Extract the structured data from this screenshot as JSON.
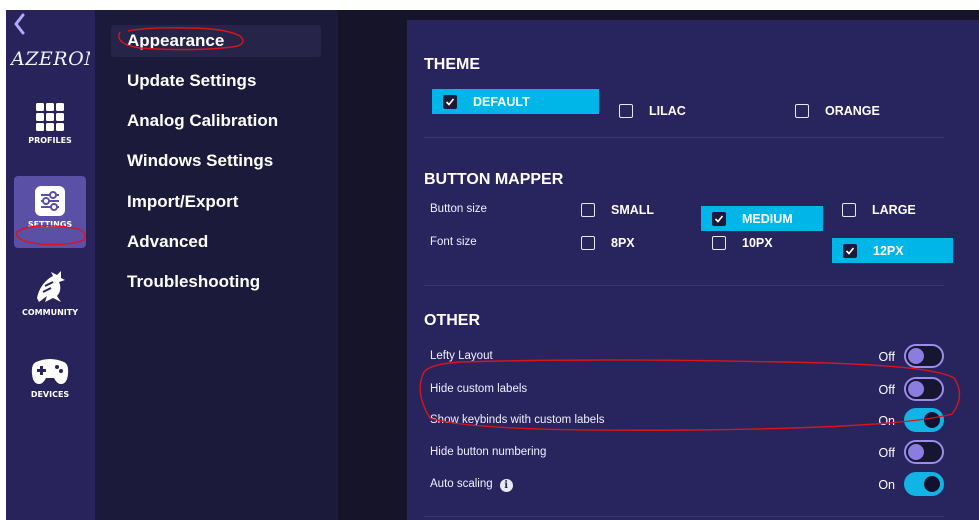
{
  "app": {
    "logo_text": "AZERON"
  },
  "rail": {
    "items": [
      {
        "label": "PROFILES",
        "icon": "grid-icon"
      },
      {
        "label": "SETTINGS",
        "icon": "sliders-icon",
        "active": true
      },
      {
        "label": "COMMUNITY",
        "icon": "dragon-icon"
      },
      {
        "label": "DEVICES",
        "icon": "gamepad-icon"
      }
    ]
  },
  "menu": {
    "items": [
      {
        "label": "Appearance",
        "active": true
      },
      {
        "label": "Update Settings"
      },
      {
        "label": "Analog Calibration"
      },
      {
        "label": "Windows Settings"
      },
      {
        "label": "Import/Export"
      },
      {
        "label": "Advanced"
      },
      {
        "label": "Troubleshooting"
      }
    ]
  },
  "theme": {
    "title": "THEME",
    "options": [
      {
        "label": "DEFAULT",
        "checked": true
      },
      {
        "label": "LILAC",
        "checked": false
      },
      {
        "label": "ORANGE",
        "checked": false
      }
    ]
  },
  "button_mapper": {
    "title": "BUTTON MAPPER",
    "button_size": {
      "label": "Button size",
      "options": [
        {
          "label": "SMALL",
          "checked": false
        },
        {
          "label": "MEDIUM",
          "checked": true
        },
        {
          "label": "LARGE",
          "checked": false
        }
      ]
    },
    "font_size": {
      "label": "Font size",
      "options": [
        {
          "label": "8PX",
          "checked": false
        },
        {
          "label": "10PX",
          "checked": false
        },
        {
          "label": "12PX",
          "checked": true
        }
      ]
    }
  },
  "other": {
    "title": "OTHER",
    "settings": [
      {
        "label": "Lefty Layout",
        "state_text": "Off",
        "on": false
      },
      {
        "label": "Hide custom labels",
        "state_text": "Off",
        "on": false
      },
      {
        "label": "Show keybinds with custom labels",
        "state_text": "On",
        "on": true
      },
      {
        "label": "Hide button numbering",
        "state_text": "Off",
        "on": false
      },
      {
        "label": "Auto scaling",
        "state_text": "On",
        "on": true,
        "info_icon": "info-icon"
      }
    ]
  },
  "colors": {
    "accent": "#00b6e8",
    "annotation": "#d8141c",
    "panel": "#28245e",
    "rail": "#28235a"
  }
}
